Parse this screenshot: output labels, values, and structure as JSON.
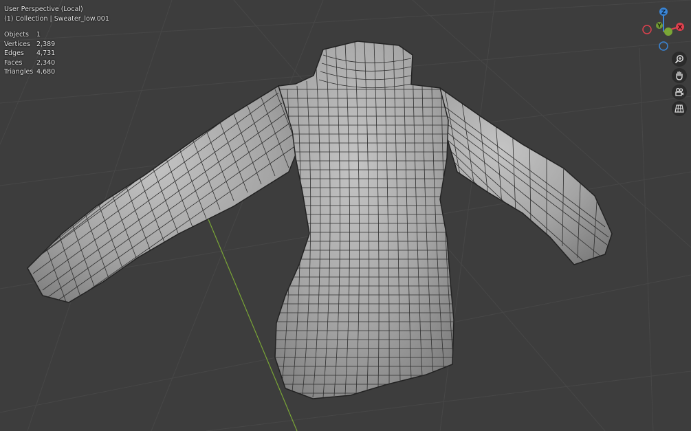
{
  "viewport": {
    "title": "User Perspective (Local)",
    "collection_line": "(1) Collection | Sweater_low.001",
    "object_name": "Sweater_low.001",
    "background_color": "#3d3d3d",
    "grid_color": "#474747",
    "y_axis_color": "#7aa636",
    "mesh_color": "#a9a9a9"
  },
  "stats": [
    {
      "label": "Objects",
      "value": "1"
    },
    {
      "label": "Vertices",
      "value": "2,389"
    },
    {
      "label": "Edges",
      "value": "4,731"
    },
    {
      "label": "Faces",
      "value": "2,340"
    },
    {
      "label": "Triangles",
      "value": "4,680"
    }
  ],
  "gizmo": {
    "z_label": "Z",
    "y_label": "Y",
    "x_label": "X",
    "x_color": "#e0414e",
    "y_color": "#7aa636",
    "z_color": "#3a86d8"
  },
  "nav_buttons": [
    {
      "name": "zoom-button",
      "icon": "zoom-icon"
    },
    {
      "name": "pan-button",
      "icon": "hand-icon"
    },
    {
      "name": "camera-view-button",
      "icon": "camera-icon"
    },
    {
      "name": "ortho-toggle-button",
      "icon": "grid-icon"
    }
  ]
}
